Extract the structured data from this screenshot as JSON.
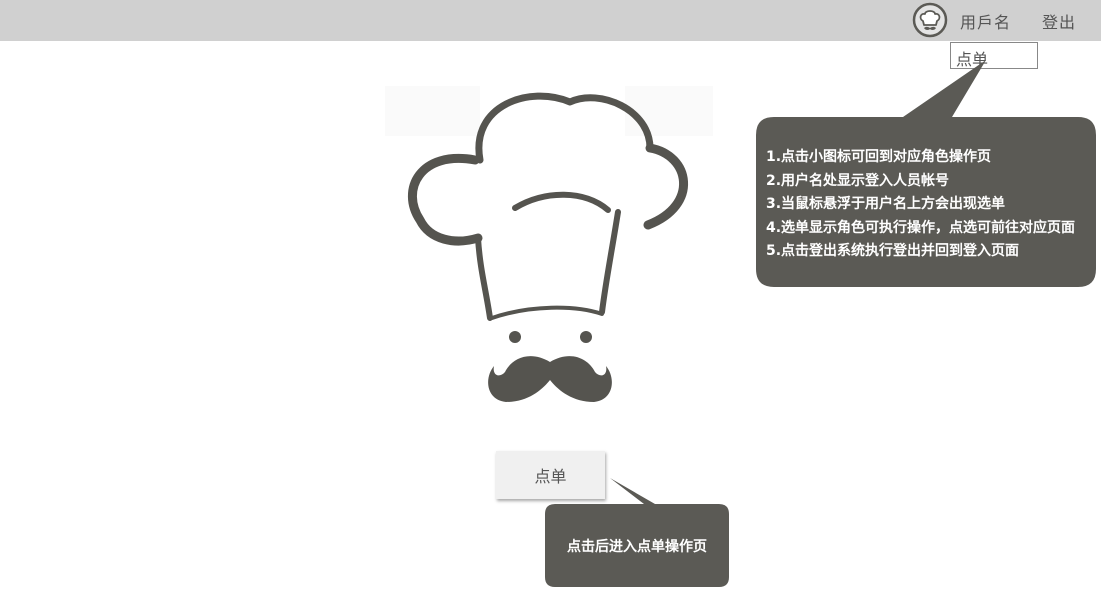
{
  "header": {
    "role_icon": "chef-hat-icon",
    "username": "用戶名",
    "logout": "登出"
  },
  "dropdown": {
    "item": "点单"
  },
  "main": {
    "logo": "chef-logo",
    "order_button": "点单"
  },
  "annotations": {
    "header_note": [
      "1.点击小图标可回到对应角色操作页",
      "2.用户名处显示登入人员帐号",
      "3.当鼠标悬浮于用户名上方会出现选单",
      "4.选单显示角色可执行操作，点选可前往对应页面",
      "5.点击登出系统执行登出并回到登入页面"
    ],
    "button_note": "点击后进入点单操作页"
  },
  "colors": {
    "topbar": "#d0d0d0",
    "callout": "#5b5a55",
    "logo": "#55544f"
  }
}
